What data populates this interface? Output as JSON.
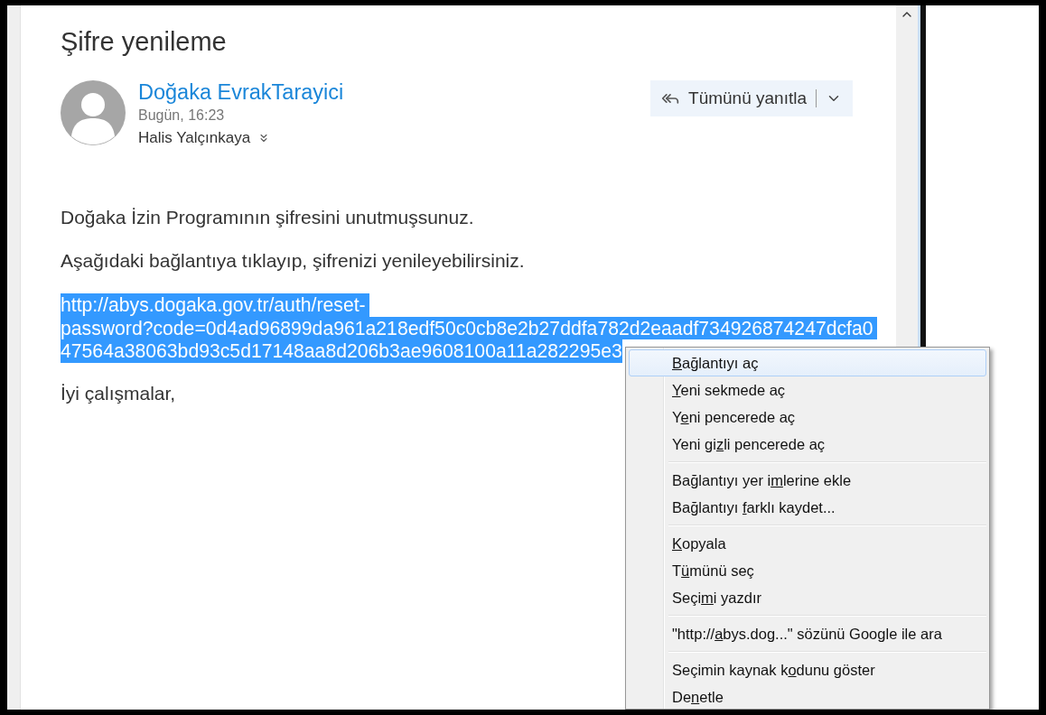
{
  "message": {
    "subject": "Şifre yenileme",
    "sender": "Doğaka EvrakTarayici",
    "date": "Bugün, 16:23",
    "recipient": "Halis Yalçınkaya",
    "reply_button": {
      "label": "Tümünü yanıtla"
    },
    "paragraphs": [
      "Doğaka İzin Programının şifresini unutmuşsunuz.",
      "Aşağıdaki bağlantıya tıklayıp, şifrenizi yenileyebilirsiniz."
    ],
    "link": {
      "selected": true,
      "lines": [
        "http://abys.dogaka.gov.tr/auth/reset-",
        "password?code=0d4ad96899da961a218edf50c0cb8e2b27ddfa782d2eaadf734926874247dcfa0",
        "47564a38063bd93c5d17148aa8d206b3ae9608100a11a282295e3"
      ]
    },
    "closing": "İyi çalışmalar,"
  },
  "context_menu": {
    "groups": [
      [
        {
          "key": "B",
          "post": "ağlantıyı aç",
          "selected": true
        },
        {
          "key": "Y",
          "post": "eni sekmede aç",
          "selected": false
        },
        {
          "pre": "Y",
          "key": "e",
          "post": "ni pencerede aç",
          "selected": false
        },
        {
          "pre": "Yeni gi",
          "key": "z",
          "post": "li pencerede aç",
          "selected": false
        }
      ],
      [
        {
          "pre": "Bağlantıyı yer i",
          "key": "m",
          "post": "lerine ekle",
          "selected": false
        },
        {
          "pre": "Bağlantıyı ",
          "key": "f",
          "post": "arklı kaydet...",
          "selected": false
        }
      ],
      [
        {
          "key": "K",
          "post": "opyala",
          "selected": false
        },
        {
          "pre": "T",
          "key": "ü",
          "post": "münü seç",
          "selected": false
        },
        {
          "pre": "Seçi",
          "key": "m",
          "post": "i yazdır",
          "selected": false
        }
      ],
      [
        {
          "pre": "\"http://",
          "key": "a",
          "post": "bys.dog...\" sözünü Google ile ara",
          "selected": false
        }
      ],
      [
        {
          "pre": "Seçimin kaynak k",
          "key": "o",
          "post": "dunu göster",
          "selected": false
        },
        {
          "pre": "De",
          "key": "n",
          "post": "etle",
          "selected": false
        }
      ]
    ]
  }
}
